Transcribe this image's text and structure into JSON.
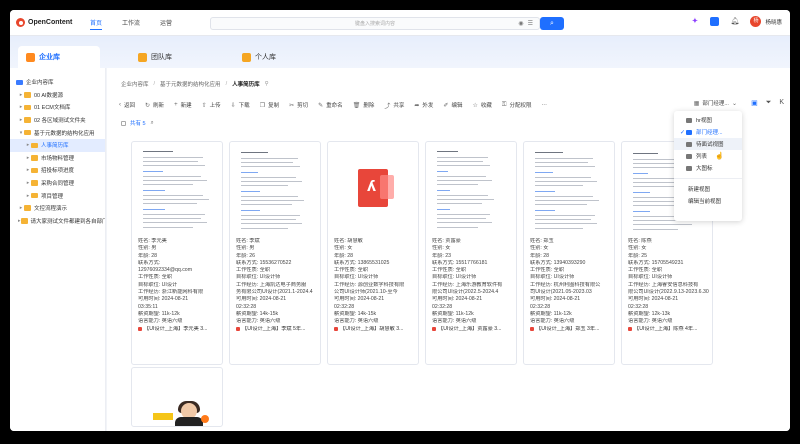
{
  "brand": {
    "logo_text": "OpenContent"
  },
  "nav": {
    "items": [
      "首页",
      "工作流",
      "运营"
    ],
    "active_index": 0
  },
  "search": {
    "placeholder": "键盘入搜索词内容",
    "button_icon": "search-icon"
  },
  "header": {
    "username": "杨晓惠",
    "avatar_text": "杨"
  },
  "library_tabs": [
    {
      "label": "企业库",
      "active": true
    },
    {
      "label": "团队库",
      "active": false
    },
    {
      "label": "个人库",
      "active": false
    }
  ],
  "sidebar": {
    "items": [
      {
        "label": "企业内容库",
        "level": 0,
        "active": false
      },
      {
        "label": "00 AI数据源",
        "level": 1,
        "active": false
      },
      {
        "label": "01 ECM文档库",
        "level": 1,
        "active": false
      },
      {
        "label": "02 各区域测试文件夹",
        "level": 1,
        "active": false
      },
      {
        "label": "基于元数据的结构化应用",
        "level": 1,
        "active": false
      },
      {
        "label": "人事简历库",
        "level": 2,
        "active": true
      },
      {
        "label": "市场物料管理",
        "level": 2,
        "active": false
      },
      {
        "label": "招投标项进度",
        "level": 2,
        "active": false
      },
      {
        "label": "采购合同管理",
        "level": 2,
        "active": false
      },
      {
        "label": "项目管理",
        "level": 2,
        "active": false
      },
      {
        "label": "文控流程演示",
        "level": 1,
        "active": false
      },
      {
        "label": "请大家测试文件都建到各自部门",
        "level": 1,
        "active": false
      }
    ]
  },
  "breadcrumb": [
    "企业内容库",
    "基于元数据的结构化应用",
    "人事简历库"
  ],
  "toolbar": {
    "items": [
      "返回",
      "刷新",
      "新建",
      "上传",
      "下载",
      "复制",
      "剪切",
      "重命名",
      "删除",
      "共享",
      "外发",
      "编辑",
      "收藏",
      "分配权限",
      "···"
    ],
    "view_label": "部门经理..."
  },
  "subbar": {
    "count_text": "共有 5"
  },
  "cards": [
    {
      "thumb": "doc",
      "name": "姓名: 李元美",
      "gender": "性别: 男",
      "age": "年龄: 28",
      "contact": "联系方式:",
      "contact2": "12976092334@qq.com",
      "worktype": "工作性质: 全职",
      "target": "目标职位: UI设计",
      "history": "工作经历: 浙江新能网科有限",
      "history2": "",
      "avail": "可用时间: 2024-08-21",
      "avail2": "03:35:11",
      "salary": "薪资期望: 11k-12k",
      "lang": "语言能力: 英语六级",
      "file": "【UI设计_上海】李元美 3..."
    },
    {
      "thumb": "doc",
      "name": "姓名: 李斌",
      "gender": "性别: 男",
      "age": "年龄: 26",
      "contact": "联系方式: 15536270522",
      "contact2": "",
      "worktype": "工作性质: 全职",
      "target": "目标职位: UI设计师",
      "history": "工作经历: 上海凯达电子商务服",
      "history2": "务有限公司UI设计(2021.1-2024.4",
      "avail": "可用时间: 2024-08-21",
      "avail2": "02:32:28",
      "salary": "薪资期望: 14k-15k",
      "lang": "语言能力: 英语六级",
      "file": "【UI设计_上海】李斌 5年..."
    },
    {
      "thumb": "pdf",
      "name": "姓名: 胡慧敏",
      "gender": "性别: 女",
      "age": "年龄: 28",
      "contact": "联系方式: 13865531025",
      "contact2": "",
      "worktype": "工作性质: 全职",
      "target": "目标职位: UI设计师",
      "history": "工作经历: 源创业数字科技有限",
      "history2": "公司UI设计师(2021.10-至今",
      "avail": "可用时间: 2024-08-21",
      "avail2": "02:32:28",
      "salary": "薪资期望: 14k-15k",
      "lang": "语言能力: 英语六级",
      "file": "【UI设计_上海】胡慧敏 3..."
    },
    {
      "thumb": "doc",
      "name": "姓名: 贾露豪",
      "gender": "性别: 女",
      "age": "年龄: 23",
      "contact": "联系方式: 15517766181",
      "contact2": "",
      "worktype": "工作性质: 全职",
      "target": "目标职位: UI设计师",
      "history": "工作经历: 上海乐游教育软件有",
      "history2": "限公司UI设计(2022.5-2024.4",
      "avail": "可用时间: 2024-08-21",
      "avail2": "02:32:28",
      "salary": "薪资期望: 11k-12k",
      "lang": "语言能力: 英语六级",
      "file": "【UI设计_上海】贾露豪 3..."
    },
    {
      "thumb": "doc",
      "name": "姓名: 郑玉",
      "gender": "性别: 女",
      "age": "年龄: 28",
      "contact": "联系方式: 13940393290",
      "contact2": "",
      "worktype": "工作性质: 全职",
      "target": "目标职位: UI设计师",
      "history": "工作经历: 杭州利图科技有限公",
      "history2": "司UI设计(2021.05-2023.03",
      "avail": "可用时间: 2024-08-21",
      "avail2": "02:32:28",
      "salary": "薪资期望: 11k-12k",
      "lang": "语言能力: 英语六级",
      "file": "【UI设计_上海】郑玉 3年..."
    },
    {
      "thumb": "doc",
      "name": "姓名: 陈燕",
      "gender": "性别: 女",
      "age": "年龄: 25",
      "contact": "联系方式: 15705549231",
      "contact2": "",
      "worktype": "工作性质: 全职",
      "target": "目标职位: UI设计师",
      "history": "工作经历: 上海睿安信息科技有",
      "history2": "限公司UI设计(2022.9.13-2023.6.30",
      "avail": "可用时间: 2024-08-21",
      "avail2": "02:32:28",
      "salary": "薪资期望: 12k-13k",
      "lang": "语言能力: 英语六级",
      "file": "【UI设计_上海】陈燕 4年..."
    },
    {
      "thumb": "photo"
    }
  ],
  "view_menu": {
    "items": [
      {
        "label": "hr视图",
        "selected": false,
        "hover": false
      },
      {
        "label": "部门经理...",
        "selected": true,
        "hover": false
      },
      {
        "label": "待面试视图",
        "selected": false,
        "hover": true
      },
      {
        "label": "列表",
        "selected": false,
        "hover": false
      },
      {
        "label": "大图标",
        "selected": false,
        "hover": false
      }
    ],
    "actions": [
      "新建视图",
      "编辑当前视图"
    ]
  },
  "colors": {
    "accent": "#1f6fff",
    "brand": "#e8462c",
    "folder": "#f5b335",
    "pdf": "#e8463a"
  }
}
